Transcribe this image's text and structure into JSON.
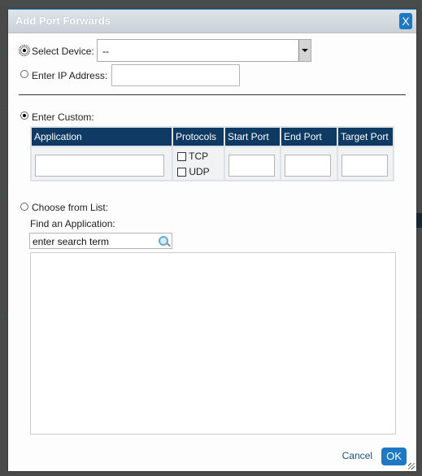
{
  "dialog": {
    "title": "Add Port Forwards",
    "close_label": "X",
    "select_device": {
      "label": "Select Device:",
      "value": "--",
      "checked": true
    },
    "enter_ip": {
      "label": "Enter IP Address:",
      "value": ""
    },
    "enter_custom": {
      "label": "Enter Custom:",
      "columns": [
        "Application",
        "Protocols",
        "Start Port",
        "End Port",
        "Target Port"
      ],
      "protocols": [
        {
          "label": "TCP",
          "checked": false
        },
        {
          "label": "UDP",
          "checked": false
        }
      ]
    },
    "choose_list": {
      "label": "Choose from List:",
      "find_label": "Find an Application:",
      "search_value": "enter search term"
    },
    "cancel_label": "Cancel",
    "ok_label": "OK"
  }
}
